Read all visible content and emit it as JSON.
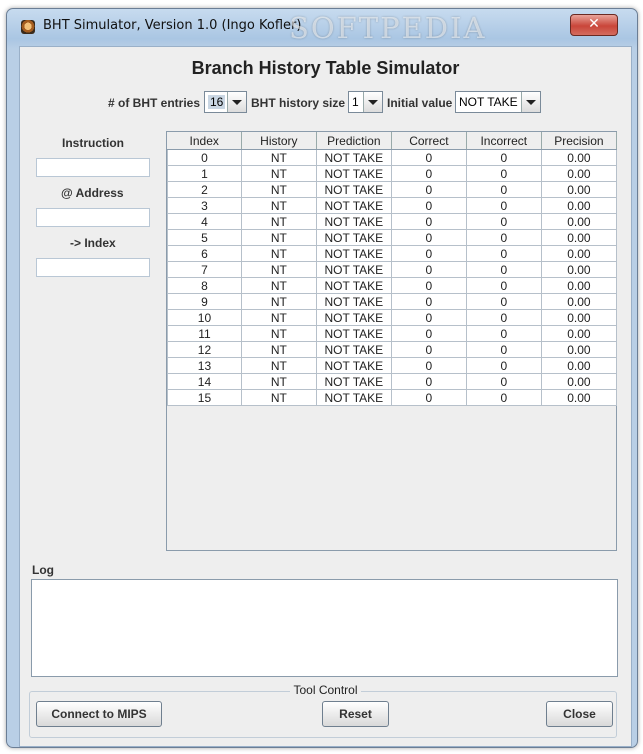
{
  "window": {
    "title": "BHT Simulator, Version 1.0 (Ingo Kofler)",
    "watermark": "SOFTPEDIA",
    "close_glyph": "✕"
  },
  "main": {
    "title": "Branch History Table Simulator"
  },
  "config": {
    "entries_label": "# of BHT entries",
    "entries_value": "16",
    "history_label": "BHT history size",
    "history_value": "1",
    "initial_label": "Initial value",
    "initial_value": "NOT TAKE"
  },
  "left_panel": {
    "instruction_label": "Instruction",
    "instruction_value": "",
    "address_label": "@ Address",
    "address_value": "",
    "index_label": "-> Index",
    "index_value": ""
  },
  "table": {
    "columns": [
      "Index",
      "History",
      "Prediction",
      "Correct",
      "Incorrect",
      "Precision"
    ],
    "rows": [
      [
        "0",
        "NT",
        "NOT TAKE",
        "0",
        "0",
        "0.00"
      ],
      [
        "1",
        "NT",
        "NOT TAKE",
        "0",
        "0",
        "0.00"
      ],
      [
        "2",
        "NT",
        "NOT TAKE",
        "0",
        "0",
        "0.00"
      ],
      [
        "3",
        "NT",
        "NOT TAKE",
        "0",
        "0",
        "0.00"
      ],
      [
        "4",
        "NT",
        "NOT TAKE",
        "0",
        "0",
        "0.00"
      ],
      [
        "5",
        "NT",
        "NOT TAKE",
        "0",
        "0",
        "0.00"
      ],
      [
        "6",
        "NT",
        "NOT TAKE",
        "0",
        "0",
        "0.00"
      ],
      [
        "7",
        "NT",
        "NOT TAKE",
        "0",
        "0",
        "0.00"
      ],
      [
        "8",
        "NT",
        "NOT TAKE",
        "0",
        "0",
        "0.00"
      ],
      [
        "9",
        "NT",
        "NOT TAKE",
        "0",
        "0",
        "0.00"
      ],
      [
        "10",
        "NT",
        "NOT TAKE",
        "0",
        "0",
        "0.00"
      ],
      [
        "11",
        "NT",
        "NOT TAKE",
        "0",
        "0",
        "0.00"
      ],
      [
        "12",
        "NT",
        "NOT TAKE",
        "0",
        "0",
        "0.00"
      ],
      [
        "13",
        "NT",
        "NOT TAKE",
        "0",
        "0",
        "0.00"
      ],
      [
        "14",
        "NT",
        "NOT TAKE",
        "0",
        "0",
        "0.00"
      ],
      [
        "15",
        "NT",
        "NOT TAKE",
        "0",
        "0",
        "0.00"
      ]
    ]
  },
  "log": {
    "label": "Log",
    "content": ""
  },
  "tool_control": {
    "title": "Tool Control",
    "connect_label": "Connect to MIPS",
    "reset_label": "Reset",
    "close_label": "Close"
  }
}
